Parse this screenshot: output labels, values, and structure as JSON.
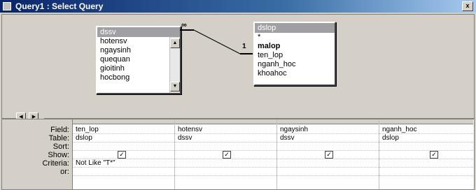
{
  "window": {
    "title": "Query1 : Select Query",
    "close_label": "x"
  },
  "tables": [
    {
      "name": "dssv",
      "fields": [
        "hotensv",
        "ngaysinh",
        "quequan",
        "gioitinh",
        "hocbong"
      ]
    },
    {
      "name": "dslop",
      "fields": [
        "*",
        "malop",
        "ten_lop",
        "nganh_hoc",
        "khoahoc"
      ]
    }
  ],
  "join": {
    "left_marker": "∞",
    "right_marker": "1"
  },
  "grid": {
    "row_labels": [
      "Field:",
      "Table:",
      "Sort:",
      "Show:",
      "Criteria:",
      "or:"
    ],
    "columns": [
      {
        "field": "ten_lop",
        "table": "dslop",
        "sort": "",
        "show": true,
        "criteria": "Not Like \"T*\"",
        "or": ""
      },
      {
        "field": "hotensv",
        "table": "dssv",
        "sort": "",
        "show": true,
        "criteria": "",
        "or": ""
      },
      {
        "field": "ngaysinh",
        "table": "dssv",
        "sort": "",
        "show": true,
        "criteria": "",
        "or": ""
      },
      {
        "field": "nganh_hoc",
        "table": "dslop",
        "sort": "",
        "show": true,
        "criteria": "",
        "or": ""
      }
    ]
  }
}
